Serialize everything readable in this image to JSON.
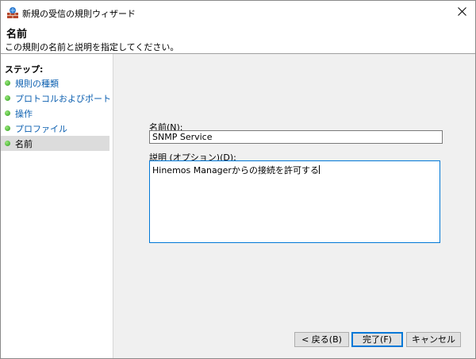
{
  "window": {
    "title": "新規の受信の規則ウィザード"
  },
  "header": {
    "title": "名前",
    "description": "この規則の名前と説明を指定してください。"
  },
  "sidebar": {
    "steps_label": "ステップ:",
    "steps": [
      {
        "label": "規則の種類",
        "current": false
      },
      {
        "label": "プロトコルおよびポート",
        "current": false
      },
      {
        "label": "操作",
        "current": false
      },
      {
        "label": "プロファイル",
        "current": false
      },
      {
        "label": "名前",
        "current": true
      }
    ]
  },
  "form": {
    "name_label": "名前(N):",
    "name_value": "SNMP Service",
    "description_label": "説明 (オプション)(D):",
    "description_value": "Hinemos Managerからの接続を許可する"
  },
  "buttons": {
    "back": "< 戻る(B)",
    "finish": "完了(F)",
    "cancel": "キャンセル"
  }
}
